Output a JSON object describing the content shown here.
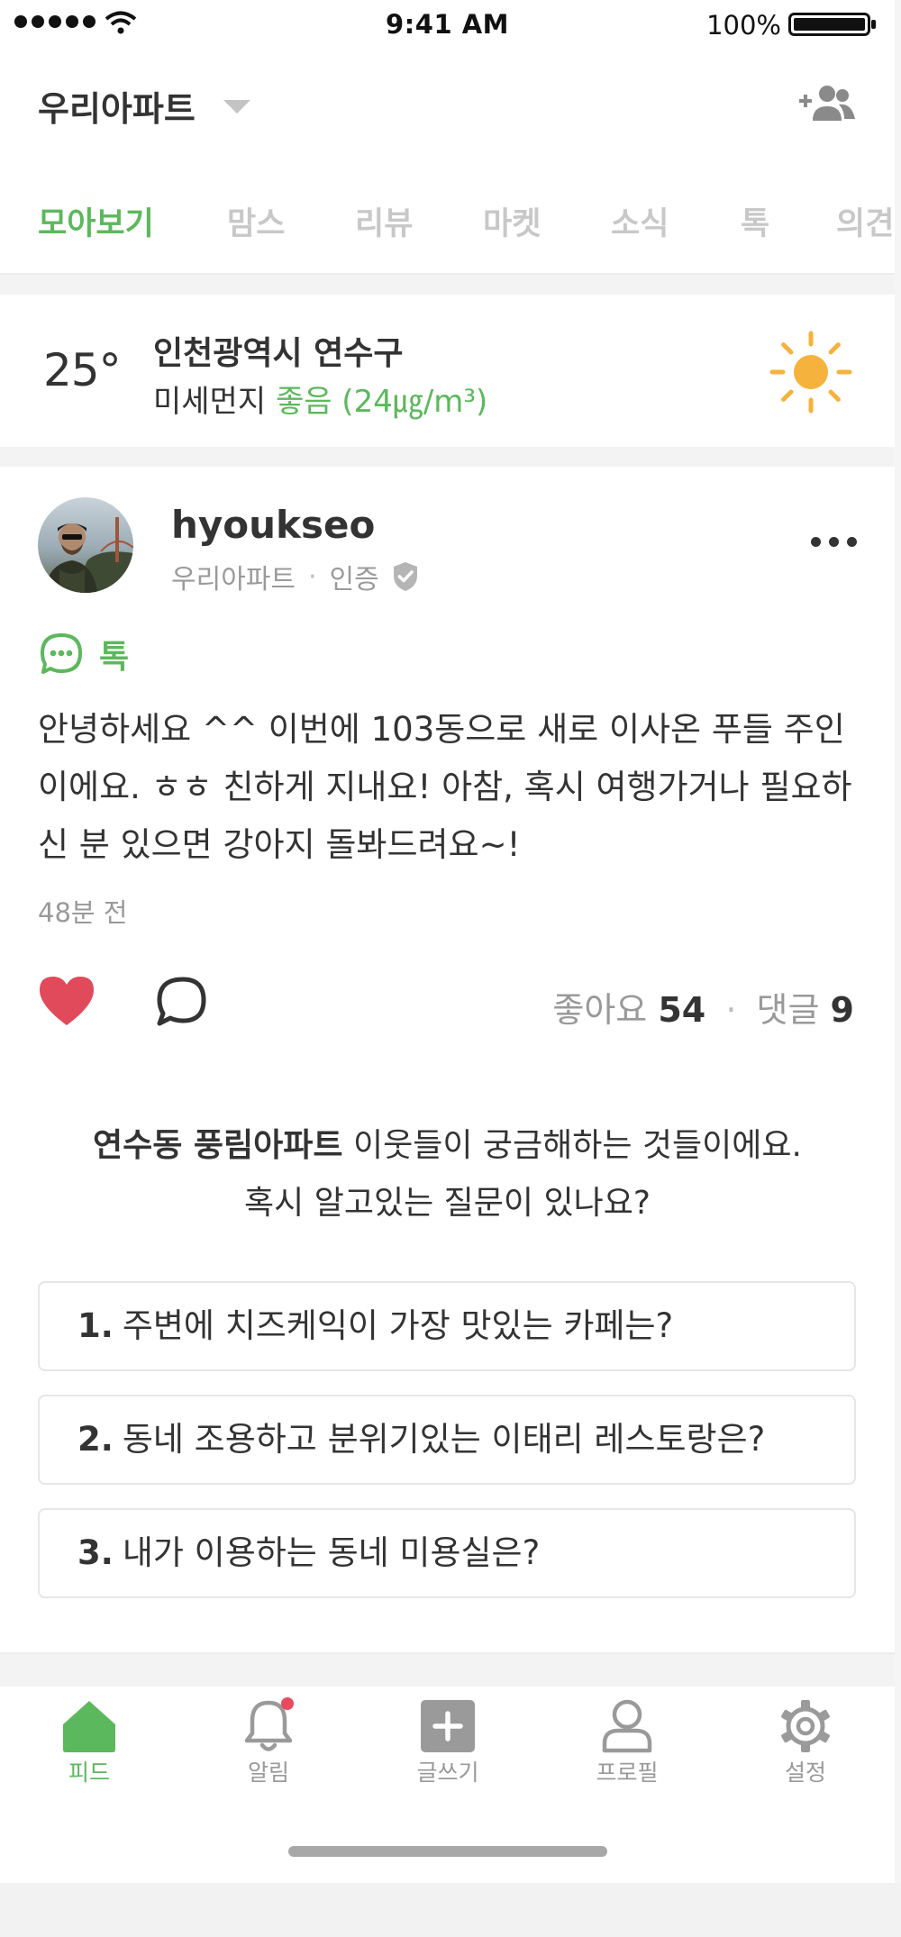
{
  "status_bar": {
    "time": "9:41 AM",
    "battery": "100%"
  },
  "header": {
    "title": "우리아파트",
    "add_user_icon": "add-user-icon"
  },
  "tabs": [
    {
      "label": "모아보기",
      "active": true
    },
    {
      "label": "맘스"
    },
    {
      "label": "리뷰"
    },
    {
      "label": "마켓"
    },
    {
      "label": "소식"
    },
    {
      "label": "톡"
    },
    {
      "label": "의견"
    }
  ],
  "weather": {
    "temperature": "25°",
    "location": "인천광역시 연수구",
    "dust_label": "미세먼지",
    "dust_status": "좋음 (24㎍/m³)",
    "icon": "sun-icon"
  },
  "post": {
    "username": "hyoukseo",
    "apartment": "우리아파트",
    "separator": "·",
    "verified": "인증",
    "category": "톡",
    "body": "안녕하세요 ^^ 이번에 103동으로 새로 이사온 푸들 주인이에요. ㅎㅎ 친하게 지내요! 아참, 혹시 여행가거나 필요하신 분 있으면 강아지 돌봐드려요~!",
    "time": "48분 전",
    "likes_label": "좋아요",
    "likes": "54",
    "comments_label": "댓글",
    "comments": "9",
    "count_sep": "·"
  },
  "questions": {
    "intro_bold": "연수동 풍림아파트",
    "intro_rest": " 이웃들이 궁금해하는 것들이에요.",
    "intro_line2": "혹시 알고있는 질문이 있나요?",
    "items": [
      {
        "num": "1.",
        "text": "주변에 치즈케익이 가장 맛있는 카페는?"
      },
      {
        "num": "2.",
        "text": "동네 조용하고 분위기있는 이태리 레스토랑은?"
      },
      {
        "num": "3.",
        "text": "내가 이용하는 동네 미용실은?"
      }
    ]
  },
  "bottom_nav": [
    {
      "label": "피드",
      "icon": "home-icon",
      "active": true
    },
    {
      "label": "알림",
      "icon": "bell-icon",
      "badge": true
    },
    {
      "label": "글쓰기",
      "icon": "plus-square-icon"
    },
    {
      "label": "프로필",
      "icon": "profile-icon"
    },
    {
      "label": "설정",
      "icon": "gear-icon"
    }
  ],
  "colors": {
    "accent": "#5cb85c",
    "like": "#e04a5a",
    "sun": "#f5b23c"
  }
}
